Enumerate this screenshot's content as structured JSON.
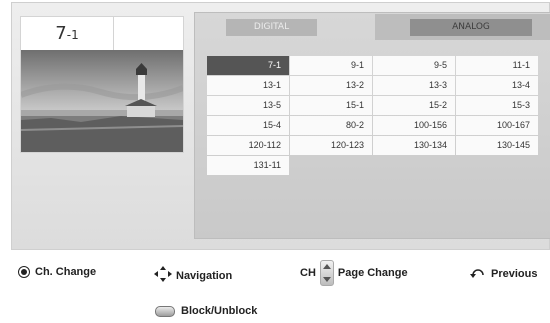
{
  "current_channel": {
    "major": "7",
    "minor": "-1"
  },
  "tabs": [
    {
      "label": "DIGITAL"
    },
    {
      "label": "ANALOG"
    }
  ],
  "channels": [
    "7-1",
    "9-1",
    "9-5",
    "11-1",
    "13-1",
    "13-2",
    "13-3",
    "13-4",
    "13-5",
    "15-1",
    "15-2",
    "15-3",
    "15-4",
    "80-2",
    "100-156",
    "100-167",
    "120-112",
    "120-123",
    "130-134",
    "130-145",
    "131-11"
  ],
  "selected_channel": "7-1",
  "legend": {
    "ch_change": "Ch. Change",
    "navigation": "Navigation",
    "ch_prefix": "CH",
    "page_change": "Page Change",
    "previous": "Previous",
    "block": "Block/Unblock"
  },
  "icons": [
    "ok-button-icon",
    "navigation-arrows-icon",
    "ch-rocker-icon",
    "return-icon",
    "block-button-icon"
  ]
}
